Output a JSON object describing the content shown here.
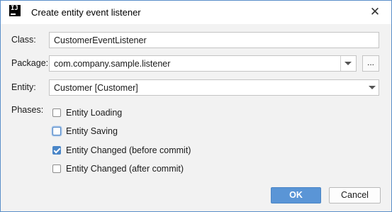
{
  "window": {
    "title": "Create entity event listener",
    "app_icon": "intellij-idea-icon",
    "close_icon": "close-icon",
    "close_glyph": "✕"
  },
  "form": {
    "class_label": "Class:",
    "class_value": "CustomerEventListener",
    "package_label": "Package:",
    "package_value": "com.company.sample.listener",
    "browse_label": "...",
    "entity_label": "Entity:",
    "entity_value": "Customer [Customer]",
    "phases_label": "Phases:"
  },
  "phases": [
    {
      "label": "Entity Loading",
      "checked": false
    },
    {
      "label": "Entity Saving",
      "checked": false
    },
    {
      "label": "Entity Changed (before commit)",
      "checked": true
    },
    {
      "label": "Entity Changed (after commit)",
      "checked": false
    }
  ],
  "buttons": {
    "ok": "OK",
    "cancel": "Cancel"
  },
  "colors": {
    "accent": "#5a95d6",
    "border": "#5b8fc9",
    "checked": "#4a86c8"
  }
}
